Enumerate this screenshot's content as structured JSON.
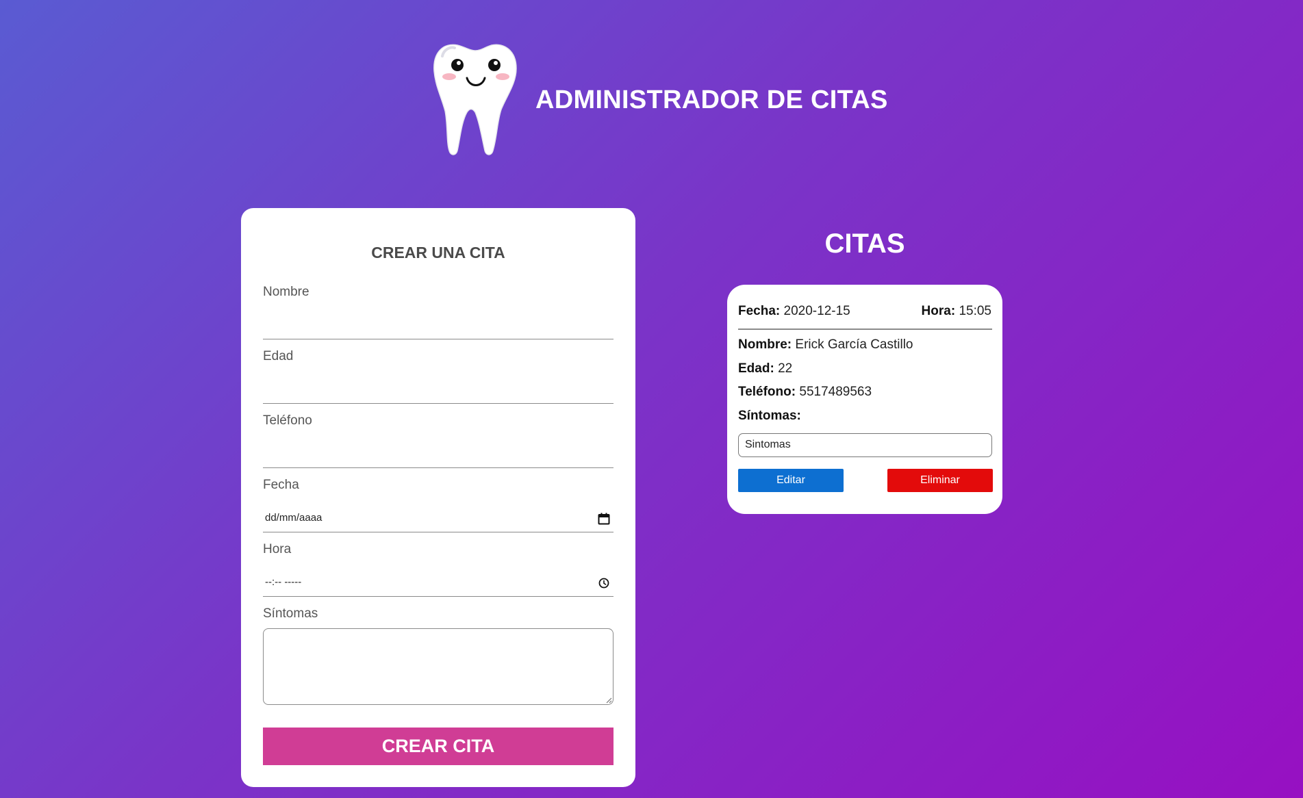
{
  "header": {
    "title": "ADMINISTRADOR DE CITAS",
    "logo_icon": "tooth-mascot-icon"
  },
  "form": {
    "title": "CREAR UNA CITA",
    "fields": {
      "nombre": {
        "label": "Nombre",
        "value": ""
      },
      "edad": {
        "label": "Edad",
        "value": ""
      },
      "telefono": {
        "label": "Teléfono",
        "value": ""
      },
      "fecha": {
        "label": "Fecha",
        "placeholder": "dd/mm/aaaa",
        "icon": "calendar-icon"
      },
      "hora": {
        "label": "Hora",
        "placeholder": "--:-- -----",
        "icon": "clock-icon"
      },
      "sintomas": {
        "label": "Síntomas",
        "value": ""
      }
    },
    "submit_label": "CREAR CITA",
    "submit_color": "#d03d95"
  },
  "citas": {
    "title": "CITAS",
    "items": [
      {
        "fecha_label": "Fecha:",
        "fecha": "2020-12-15",
        "hora_label": "Hora:",
        "hora": "15:05",
        "nombre_label": "Nombre:",
        "nombre": "Erick García Castillo",
        "edad_label": "Edad:",
        "edad": "22",
        "telefono_label": "Teléfono:",
        "telefono": "5517489563",
        "sintomas_label": "Síntomas:",
        "sintomas": "Sintomas",
        "edit_label": "Editar",
        "edit_color": "#0d6fd1",
        "delete_label": "Eliminar",
        "delete_color": "#e30b0b"
      }
    ]
  },
  "colors": {
    "background_start": "#5a5bd2",
    "background_end": "#9710c2"
  }
}
